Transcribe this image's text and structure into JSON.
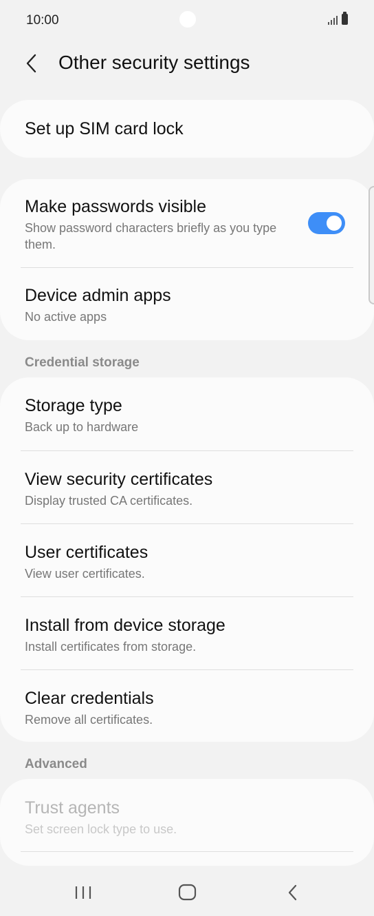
{
  "status_bar": {
    "time": "10:00"
  },
  "header": {
    "title": "Other security settings"
  },
  "sim_card": {
    "title": "Set up SIM card lock"
  },
  "passwords": {
    "title": "Make passwords visible",
    "subtitle": "Show password characters briefly as you type them.",
    "toggle_on": true,
    "accent": "#3e8ef7"
  },
  "device_admin": {
    "title": "Device admin apps",
    "subtitle": "No active apps"
  },
  "credential_storage": {
    "label": "Credential storage",
    "items": [
      {
        "title": "Storage type",
        "subtitle": "Back up to hardware"
      },
      {
        "title": "View security certificates",
        "subtitle": "Display trusted CA certificates."
      },
      {
        "title": "User certificates",
        "subtitle": "View user certificates."
      },
      {
        "title": "Install from device storage",
        "subtitle": "Install certificates from storage."
      },
      {
        "title": "Clear credentials",
        "subtitle": "Remove all certificates."
      }
    ]
  },
  "advanced": {
    "label": "Advanced",
    "items": [
      {
        "title": "Trust agents",
        "subtitle": "Set screen lock type to use.",
        "disabled": true
      }
    ]
  },
  "nav_bar": {
    "icons": [
      "recents-icon",
      "home-icon",
      "back-icon"
    ]
  }
}
